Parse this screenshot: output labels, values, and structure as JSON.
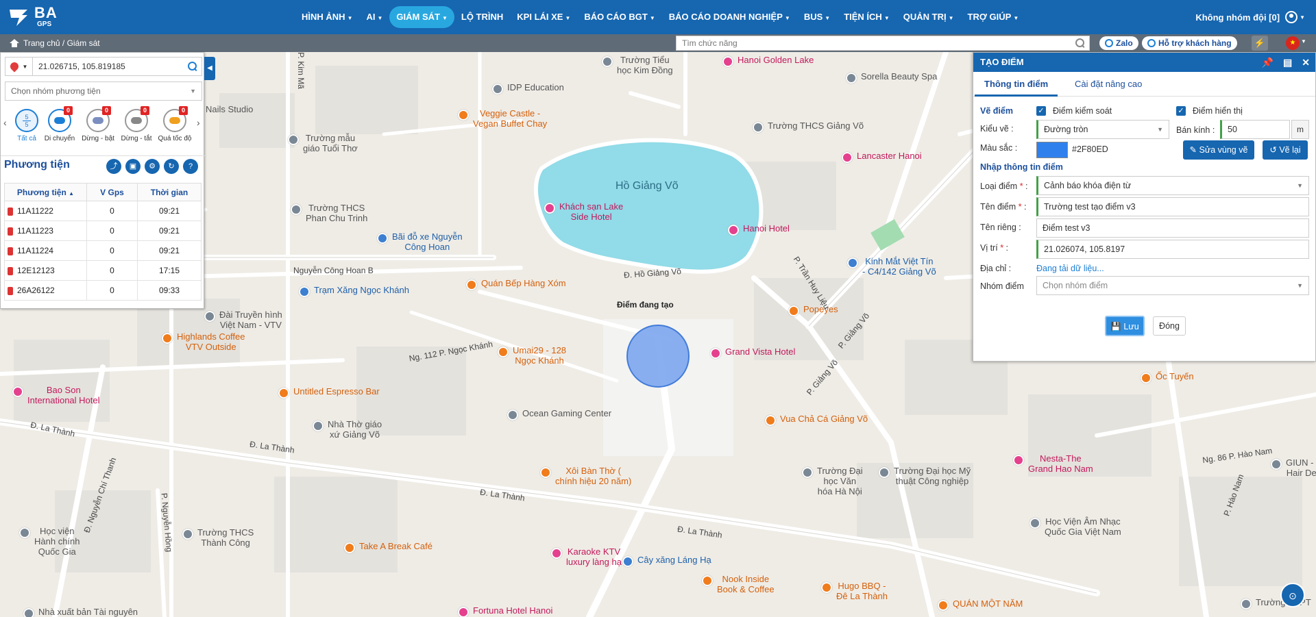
{
  "brand": {
    "name": "BA",
    "sub": "GPS"
  },
  "nav": {
    "items": [
      {
        "label": "HÌNH ẢNH",
        "caret": true
      },
      {
        "label": "AI",
        "caret": true
      },
      {
        "label": "GIÁM SÁT",
        "caret": true,
        "active": true
      },
      {
        "label": "LỘ TRÌNH",
        "caret": false
      },
      {
        "label": "KPI LÁI XE",
        "caret": true
      },
      {
        "label": "BÁO CÁO BGT",
        "caret": true
      },
      {
        "label": "BÁO CÁO DOANH NGHIỆP",
        "caret": true
      },
      {
        "label": "BUS",
        "caret": true
      },
      {
        "label": "TIỆN ÍCH",
        "caret": true
      },
      {
        "label": "QUẢN TRỊ",
        "caret": true
      },
      {
        "label": "TRỢ GIÚP",
        "caret": true
      }
    ],
    "team": "Không nhóm đội [0]"
  },
  "subbar": {
    "breadcrumb": "Trang chủ / Giám sát",
    "search_placeholder": "Tìm chức năng",
    "zalo": "Zalo",
    "support": "Hỗ trợ khách hàng"
  },
  "left": {
    "coords": "21.026715, 105.819185",
    "group_placeholder": "Chọn nhóm phương tiện",
    "statuses": [
      {
        "label": "Tất cả",
        "value": "5\n5"
      },
      {
        "label": "Di chuyển",
        "badge": "0"
      },
      {
        "label": "Dừng - bật",
        "badge": "0"
      },
      {
        "label": "Dừng - tắt",
        "badge": "0"
      },
      {
        "label": "Quá tốc độ",
        "badge": "0"
      }
    ],
    "title": "Phương tiện",
    "columns": [
      "Phương tiện",
      "V Gps",
      "Thời gian"
    ],
    "rows": [
      [
        "11A11222",
        "0",
        "09:21"
      ],
      [
        "11A11223",
        "0",
        "09:21"
      ],
      [
        "11A11224",
        "0",
        "09:21"
      ],
      [
        "12E12123",
        "0",
        "17:15"
      ],
      [
        "26A26122",
        "0",
        "09:33"
      ]
    ]
  },
  "panel": {
    "title": "TẠO ĐIỂM",
    "tab_info": "Thông tin điểm",
    "tab_adv": "Cài đặt nâng cao",
    "draw_section": "Vẽ điểm",
    "chk_control": "Điểm kiểm soát",
    "chk_display": "Điểm hiển thị",
    "draw_type_label": "Kiểu vẽ :",
    "draw_type": "Đường tròn",
    "radius_label": "Bán kính :",
    "radius": "50",
    "unit": "m",
    "color_label": "Màu sắc :",
    "color_hex": "#2F80ED",
    "edit_btn": "Sửa vùng vẽ",
    "redraw_btn": "Vẽ lại",
    "input_section": "Nhập thông tin điểm",
    "type_label": "Loại điểm",
    "type_value": "Cảnh báo khóa điện từ",
    "name_label": "Tên điểm",
    "name_value": "Trường test tạo điểm v3",
    "private_label": "Tên riêng :",
    "private_value": "Điểm test v3",
    "pos_label": "Vị trí",
    "pos_value": "21.026074, 105.8197",
    "addr_label": "Địa chỉ :",
    "addr_value": "Đang tải dữ liệu...",
    "group_label": "Nhóm điểm",
    "group_placeholder": "Chọn nhóm điểm",
    "save": "Lưu",
    "close": "Đóng"
  },
  "map": {
    "circle_label": "Điểm đang tạo",
    "lake": "Hồ Giảng Võ",
    "places": [
      {
        "t": "Trường Tiểu\nhọc Kim Đồng",
        "c": ""
      },
      {
        "t": "IDP Education",
        "c": ""
      },
      {
        "t": "Nails Studio",
        "c": ""
      },
      {
        "t": "Veggie Castle -\nVegan Buffet Chay",
        "c": "orange"
      },
      {
        "t": "Trường mẫu\ngiáo Tuổi Thơ",
        "c": ""
      },
      {
        "t": "Trường THCS\nPhan Chu Trinh",
        "c": ""
      },
      {
        "t": "Bãi đỗ xe Nguyễn\nCông Hoan",
        "c": "blue"
      },
      {
        "t": "Trạm Xăng Ngọc Khánh",
        "c": "blue"
      },
      {
        "t": "Quán Bếp Hàng Xóm",
        "c": "orange"
      },
      {
        "t": "Hanoi Golden Lake",
        "c": "pink"
      },
      {
        "t": "Sorella Beauty Spa",
        "c": ""
      },
      {
        "t": "Trường THCS Giảng Võ",
        "c": ""
      },
      {
        "t": "Lancaster Hanoi",
        "c": "pink"
      },
      {
        "t": "Khách sạn Lake\nSide Hotel",
        "c": "pink"
      },
      {
        "t": "Hanoi Hotel",
        "c": "pink"
      },
      {
        "t": "Kinh Mắt Việt Tín\n- C4/142 Giảng Võ",
        "c": "blue"
      },
      {
        "t": "Popeyes",
        "c": "orange"
      },
      {
        "t": "Grand Vista Hotel",
        "c": "pink"
      },
      {
        "t": "Đài Truyền hình\nViệt Nam - VTV",
        "c": ""
      },
      {
        "t": "Highlands Coffee\nVTV Outside",
        "c": "orange"
      },
      {
        "t": "Umai29 - 128\nNgọc Khánh",
        "c": "orange"
      },
      {
        "t": "Untitled Espresso Bar",
        "c": "orange"
      },
      {
        "t": "Ocean Gaming Center",
        "c": ""
      },
      {
        "t": "Bao Son\nInternational Hotel",
        "c": "pink"
      },
      {
        "t": "Nhà Thờ giáo\nxứ Giảng Võ",
        "c": ""
      },
      {
        "t": "Vua Chả Cá Giảng Võ",
        "c": "orange"
      },
      {
        "t": "Xôi Bàn Thờ (\nchính hiệu 20 năm)",
        "c": "orange"
      },
      {
        "t": "Trường Đại\nhọc Văn\nhóa Hà Nội",
        "c": ""
      },
      {
        "t": "Trường Đại học Mỹ\nthuật Công nghiệp",
        "c": ""
      },
      {
        "t": "Nesta-The\nGrand Hao Nam",
        "c": "pink"
      },
      {
        "t": "Ốc Tuyến",
        "c": "orange"
      },
      {
        "t": "Học Viện Âm Nhạc\nQuốc Gia Việt Nam",
        "c": ""
      },
      {
        "t": "Trường THCS\nThành Công",
        "c": ""
      },
      {
        "t": "Take A Break Café",
        "c": "orange"
      },
      {
        "t": "Karaoke KTV\nluxury làng hạ",
        "c": "pink"
      },
      {
        "t": "Cây xăng Láng Hạ",
        "c": "blue"
      },
      {
        "t": "Nook Inside\nBook & Coffee",
        "c": "orange"
      },
      {
        "t": "Hugo BBQ -\nĐê La Thành",
        "c": "orange"
      },
      {
        "t": "QUÁN MỘT NĂM",
        "c": "orange"
      },
      {
        "t": "Học viện\nHành chính\nQuốc Gia",
        "c": ""
      },
      {
        "t": "Nhà xuất bản Tài nguyên",
        "c": ""
      },
      {
        "t": "Fortuna Hotel Hanoi",
        "c": "pink"
      },
      {
        "t": "Trường THPT",
        "c": ""
      },
      {
        "t": "GIUN - Me\nHair Desig",
        "c": ""
      }
    ],
    "roads": [
      "Nguyễn Công Hoan",
      "Nguyễn Công Hoan B",
      "Ng. 112 P. Ngọc Khánh",
      "Đ. La Thành",
      "Đ. La Thành",
      "Đ. La Thành",
      "Đ. La Thành",
      "P. Giảng Võ",
      "P. Giảng Võ",
      "P. Trần Huy Liệu",
      "Đ. Hồ Giảng Võ",
      "P. Kim Mã",
      "P. Nguyễn Hồng",
      "Đ. Nguyễn Chí Thanh",
      "P. Hào Nam",
      "Ng. 86 P. Hào Nam"
    ]
  }
}
